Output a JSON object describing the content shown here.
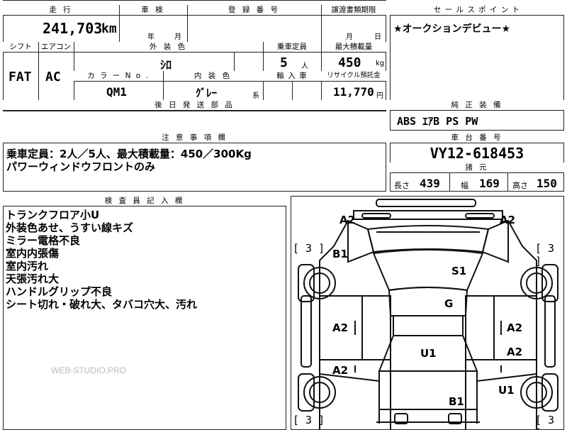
{
  "top": {
    "mileage": {
      "label": "走 行",
      "value": "241,703",
      "unit": "km"
    },
    "inspection": {
      "label": "車 検",
      "year_unit": "年",
      "month_unit": "月"
    },
    "registration": {
      "label": "登 録 番 号"
    },
    "transfer": {
      "label": "譲渡書類期限",
      "month_unit": "月",
      "day_unit": "日"
    },
    "shift": {
      "label": "シフト",
      "value": "FAT"
    },
    "aircon": {
      "label": "エアコン",
      "value": "AC"
    },
    "exterior": {
      "label": "外 装 色",
      "value": "ｼﾛ"
    },
    "color_no": {
      "label": "カ ラ ー N o .",
      "value": "QM1"
    },
    "interior": {
      "label": "内 装 色",
      "value": "ｸﾞﾚｰ",
      "suffix": "系"
    },
    "capacity": {
      "label": "乗車定員",
      "value": "5",
      "unit": "人"
    },
    "import": {
      "label": "輸 入 車"
    },
    "max_load": {
      "label": "最大積載量",
      "value": "450",
      "unit": "kg"
    },
    "recycle": {
      "label": "リサイクル預託金",
      "value": "11,770",
      "unit": "円"
    },
    "later_parts": {
      "label": "後 日 発 送 部 品"
    }
  },
  "sales_point": {
    "label": "セ ー ル ス ポ イ ン ト",
    "text": "★オークションデビュー★"
  },
  "equipment": {
    "label": "純 正 装 備",
    "text": "ABS ｴｱB PS PW"
  },
  "notes": {
    "label": "注 意 事 項 欄",
    "lines": [
      "乗車定員：2人／5人、最大積載量：450／300Kg",
      "パワーウィンドウフロントのみ"
    ]
  },
  "chassis": {
    "label": "車 台 番 号",
    "value": "VY12-618453"
  },
  "dims": {
    "label": "諸 元",
    "length_label": "長さ",
    "length": "439",
    "width_label": "幅",
    "width": "169",
    "height_label": "高さ",
    "height": "150"
  },
  "inspector": {
    "label": "検 査 員 記 入 欄",
    "lines": [
      "トランクフロア小U",
      "外装色あせ、うすい線キズ",
      "ミラー電格不良",
      "室内内張傷",
      "室内汚れ",
      "天張汚れ大",
      "ハンドルグリップ不良",
      "シート切れ・破れ大、タバコ穴大、汚れ"
    ],
    "watermark": "WEB-STUDIO.PRO"
  },
  "diagram": {
    "marks": [
      {
        "id": "top-left",
        "text": "A2"
      },
      {
        "id": "top-right",
        "text": "A2"
      },
      {
        "id": "b1-top",
        "text": "B1"
      },
      {
        "id": "s1",
        "text": "S1"
      },
      {
        "id": "g",
        "text": "G"
      },
      {
        "id": "left-mid",
        "text": "A2"
      },
      {
        "id": "right-mid",
        "text": "A2"
      },
      {
        "id": "right-mid2",
        "text": "A2"
      },
      {
        "id": "u1-center",
        "text": "U1"
      },
      {
        "id": "left-low",
        "text": "A2"
      },
      {
        "id": "u1-right",
        "text": "U1"
      },
      {
        "id": "b1-bottom",
        "text": "B1"
      }
    ],
    "tires": [
      "[ 3 ]",
      "[ 3 ]",
      "[ 3 ]",
      "[ 3 ]"
    ]
  }
}
